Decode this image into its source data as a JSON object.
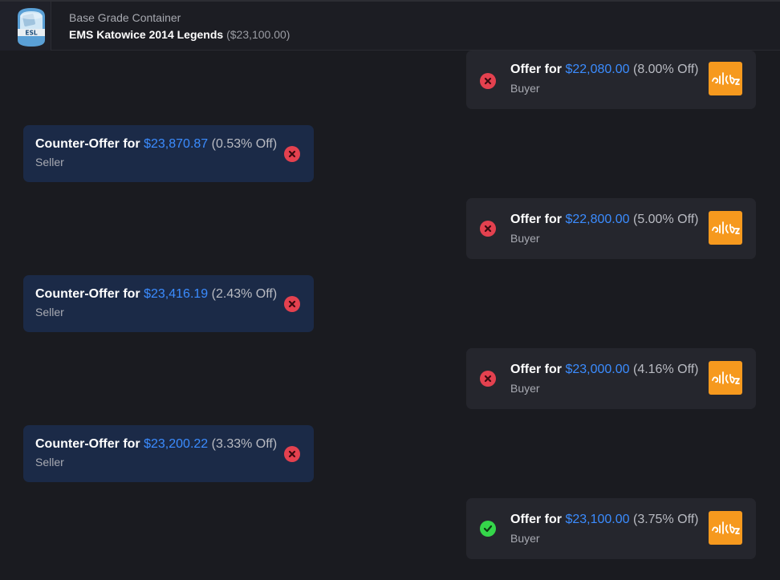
{
  "header": {
    "title": "Base Grade Container",
    "item_name": "EMS Katowice 2014 Legends",
    "item_price": "($23,100.00)",
    "thumbnail_icon": "esl-capsule-icon"
  },
  "colors": {
    "amount": "#3b8cff",
    "reject": "#e4414f",
    "accept": "#35d64a",
    "avatar_bg": "#f6991e",
    "seller_card": "#1b2a47",
    "buyer_card": "#25262d"
  },
  "messages": [
    {
      "side": "buyer",
      "label": "Offer for",
      "amount": "$22,080.00",
      "off": "(8.00% Off)",
      "role": "Buyer",
      "status": "rejected",
      "status_icon": "x-circle-icon",
      "avatar_icon": "user-avatar-icon"
    },
    {
      "side": "seller",
      "label": "Counter-Offer for",
      "amount": "$23,870.87",
      "off": "(0.53% Off)",
      "role": "Seller",
      "status": "rejected",
      "status_icon": "x-circle-icon"
    },
    {
      "side": "buyer",
      "label": "Offer for",
      "amount": "$22,800.00",
      "off": "(5.00% Off)",
      "role": "Buyer",
      "status": "rejected",
      "status_icon": "x-circle-icon",
      "avatar_icon": "user-avatar-icon"
    },
    {
      "side": "seller",
      "label": "Counter-Offer for",
      "amount": "$23,416.19",
      "off": "(2.43% Off)",
      "role": "Seller",
      "status": "rejected",
      "status_icon": "x-circle-icon"
    },
    {
      "side": "buyer",
      "label": "Offer for",
      "amount": "$23,000.00",
      "off": "(4.16% Off)",
      "role": "Buyer",
      "status": "rejected",
      "status_icon": "x-circle-icon",
      "avatar_icon": "user-avatar-icon"
    },
    {
      "side": "seller",
      "label": "Counter-Offer for",
      "amount": "$23,200.22",
      "off": "(3.33% Off)",
      "role": "Seller",
      "status": "rejected",
      "status_icon": "x-circle-icon"
    },
    {
      "side": "buyer",
      "label": "Offer for",
      "amount": "$23,100.00",
      "off": "(3.75% Off)",
      "role": "Buyer",
      "status": "accepted",
      "status_icon": "check-circle-icon",
      "avatar_icon": "user-avatar-icon"
    }
  ]
}
